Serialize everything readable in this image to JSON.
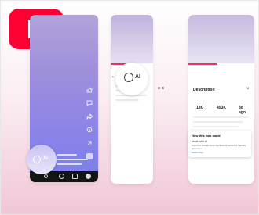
{
  "colors": {
    "brand_red": "#ff0033",
    "progress_red": "#ff2d55",
    "player_gradient": "#8d85e7"
  },
  "logo": {
    "icon": "youtube-play-icon"
  },
  "phone1": {
    "actions": [
      "like-icon",
      "comment-icon",
      "share-icon",
      "remix-icon",
      "more-icon",
      "thumbnail-icon"
    ],
    "nav": [
      "home-icon",
      "create-icon",
      "subscriptions-icon",
      "profile-icon"
    ],
    "chip_label": "AI"
  },
  "phone2": {
    "chip_label": "AI",
    "prefix_text": "•"
  },
  "phone3": {
    "title": "Description",
    "close_label": "×",
    "stats": [
      "13K",
      "453K",
      "3d ago"
    ],
    "card": {
      "title": "How this was made",
      "line1": "Made with AI",
      "line2": "Sound or visuals were significantly edited or digitally generated.",
      "link": "Learn more"
    }
  }
}
